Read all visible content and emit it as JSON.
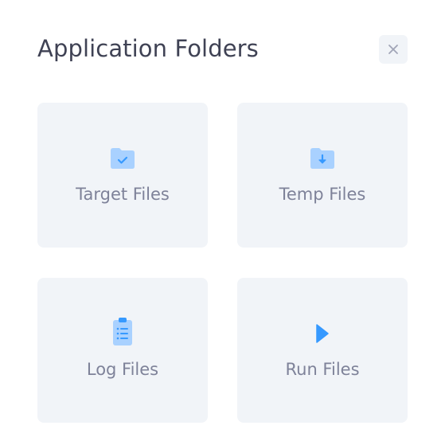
{
  "dialog": {
    "title": "Application Folders",
    "close_icon": "close-icon",
    "accent_color": "#3699ff",
    "tiles": [
      {
        "label": "Target Files",
        "icon": "folder-check-icon"
      },
      {
        "label": "Temp Files",
        "icon": "folder-download-icon"
      },
      {
        "label": "Log Files",
        "icon": "clipboard-list-icon"
      },
      {
        "label": "Run Files",
        "icon": "play-icon"
      }
    ]
  }
}
